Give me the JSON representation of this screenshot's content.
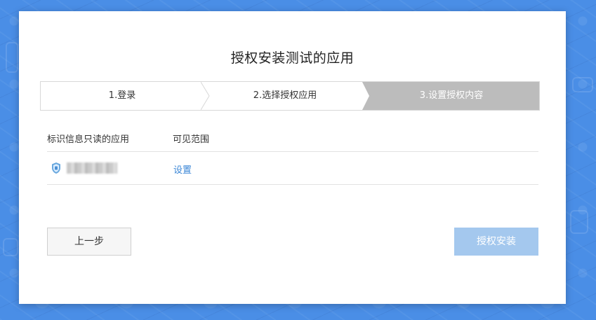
{
  "dialog": {
    "title": "授权安装测试的应用"
  },
  "steps": [
    {
      "label": "1.登录",
      "state": "done"
    },
    {
      "label": "2.选择授权应用",
      "state": "done"
    },
    {
      "label": "3.设置授权内容",
      "state": "active"
    }
  ],
  "table": {
    "headers": [
      "标识信息只读的应用",
      "可见范围"
    ],
    "rows": [
      {
        "icon": "shield-app-icon",
        "name": "",
        "action": "设置"
      }
    ]
  },
  "buttons": {
    "prev_label": "上一步",
    "install_label": "授权安装"
  },
  "colors": {
    "background": "#4a8ee6",
    "link": "#3a86d6",
    "active_step": "#bcbcbc",
    "install_disabled": "#a4c8ee"
  }
}
